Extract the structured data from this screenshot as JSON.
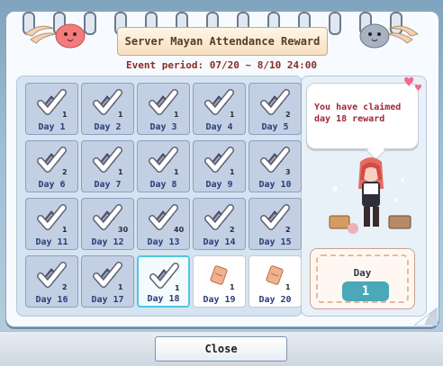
{
  "window": {
    "title": "Server Mayan Attendance Reward",
    "event_period": "Event period: 07/20 ~ 8/10 24:00"
  },
  "message": {
    "text": "You have claimed day 18 reward"
  },
  "counter": {
    "label": "Day",
    "value": "1"
  },
  "days": [
    {
      "label": "Day 1",
      "qty": "1",
      "claimed": true,
      "icon": "gear-item-icon"
    },
    {
      "label": "Day 2",
      "qty": "1",
      "claimed": true,
      "icon": "gear-item-icon"
    },
    {
      "label": "Day 3",
      "qty": "1",
      "claimed": true,
      "icon": "gear-item-icon"
    },
    {
      "label": "Day 4",
      "qty": "1",
      "claimed": true,
      "icon": "gear-item-icon"
    },
    {
      "label": "Day 5",
      "qty": "2",
      "claimed": true,
      "icon": "gear-item-icon"
    },
    {
      "label": "Day 6",
      "qty": "2",
      "claimed": true,
      "icon": "gear-item-icon"
    },
    {
      "label": "Day 7",
      "qty": "1",
      "claimed": true,
      "icon": "gear-item-icon"
    },
    {
      "label": "Day 8",
      "qty": "1",
      "claimed": true,
      "icon": "gear-item-icon"
    },
    {
      "label": "Day 9",
      "qty": "1",
      "claimed": true,
      "icon": "gear-item-icon"
    },
    {
      "label": "Day 10",
      "qty": "3",
      "claimed": true,
      "icon": "gear-item-icon"
    },
    {
      "label": "Day 11",
      "qty": "1",
      "claimed": true,
      "icon": "gear-item-icon"
    },
    {
      "label": "Day 12",
      "qty": "30",
      "claimed": true,
      "icon": "gear-item-icon"
    },
    {
      "label": "Day 13",
      "qty": "40",
      "claimed": true,
      "icon": "gear-item-icon"
    },
    {
      "label": "Day 14",
      "qty": "2",
      "claimed": true,
      "icon": "gear-item-icon"
    },
    {
      "label": "Day 15",
      "qty": "2",
      "claimed": true,
      "icon": "gear-item-icon"
    },
    {
      "label": "Day 16",
      "qty": "2",
      "claimed": true,
      "icon": "gear-item-icon"
    },
    {
      "label": "Day 17",
      "qty": "1",
      "claimed": true,
      "icon": "gear-item-icon"
    },
    {
      "label": "Day 18",
      "qty": "1",
      "claimed": true,
      "selected": true,
      "icon": "gear-item-icon"
    },
    {
      "label": "Day 19",
      "qty": "1",
      "claimed": false,
      "icon": "ticket-icon"
    },
    {
      "label": "Day 20",
      "qty": "1",
      "claimed": false,
      "icon": "ticket-icon"
    }
  ],
  "buttons": {
    "close": "Close"
  },
  "colors": {
    "accent": "#53c5e6",
    "title_text": "#5a3a2a",
    "event_text": "#8a2c24",
    "message_text": "#a4243b",
    "day_label": "#2b3d7a"
  }
}
